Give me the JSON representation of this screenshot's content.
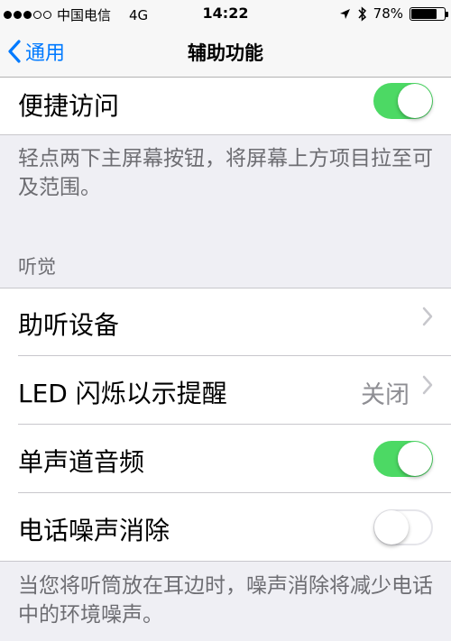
{
  "status_bar": {
    "carrier": "中国电信",
    "network": "4G",
    "time": "14:22",
    "battery": "78%",
    "battery_level": 0.78,
    "icons": [
      "location-arrow-icon",
      "bluetooth-icon"
    ]
  },
  "nav": {
    "back_label": "通用",
    "title": "辅助功能"
  },
  "reachability": {
    "label": "便捷访问",
    "enabled": true,
    "footer": "轻点两下主屏幕按钮，将屏幕上方项目拉至可及范围。"
  },
  "hearing": {
    "header": "听觉",
    "items": [
      {
        "label": "助听设备",
        "type": "link"
      },
      {
        "label": "LED 闪烁以示提醒",
        "type": "link",
        "detail": "关闭"
      },
      {
        "label": "单声道音频",
        "type": "toggle",
        "enabled": true
      },
      {
        "label": "电话噪声消除",
        "type": "toggle",
        "enabled": false
      }
    ],
    "footer": "当您将听筒放在耳边时，噪声消除将减少电话中的环境噪声。"
  },
  "colors": {
    "accent": "#007aff",
    "toggle_on": "#4cd964",
    "background": "#efeff4"
  }
}
